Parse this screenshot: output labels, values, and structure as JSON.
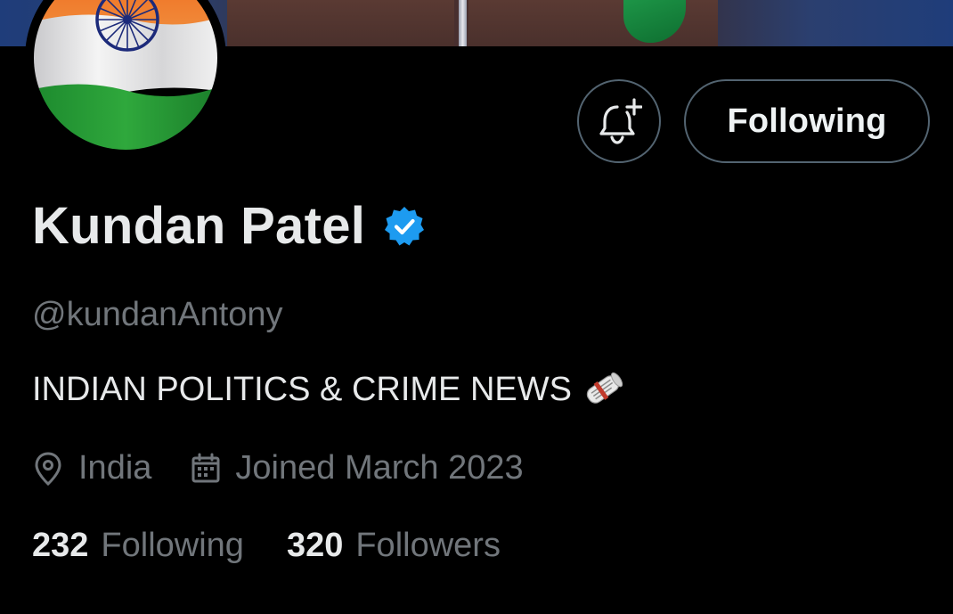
{
  "profile": {
    "display_name": "Kundan Patel",
    "handle": "@kundanAntony",
    "bio": "INDIAN POLITICS & CRIME NEWS",
    "bio_emoji": "rolled-up-newspaper-icon",
    "verified": true,
    "location": "India",
    "joined": "Joined March 2023"
  },
  "actions": {
    "notify_icon": "bell-plus-icon",
    "follow_label": "Following"
  },
  "stats": {
    "following_count": "232",
    "following_label": "Following",
    "followers_count": "320",
    "followers_label": "Followers"
  },
  "colors": {
    "background": "#000000",
    "primary_text": "#e7e9ea",
    "secondary_text": "#71767b",
    "border": "#536471",
    "verified_blue": "#1d9bf0"
  }
}
